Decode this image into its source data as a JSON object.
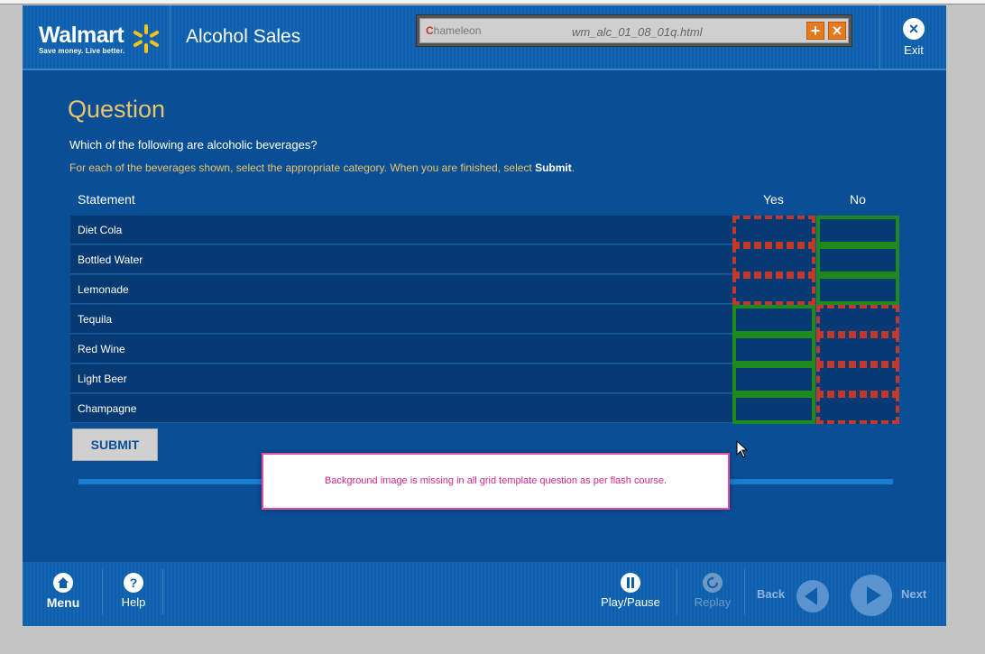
{
  "header": {
    "brand": "Walmart",
    "tagline": "Save money. Live better.",
    "app_title": "Alcohol Sales",
    "viewer": {
      "logo": "hameleon",
      "logo_initial": "C",
      "file": "wm_alc_01_08_01q.html",
      "plus_label": "+",
      "close_label": "×"
    },
    "exit_label": "Exit",
    "exit_icon": "×"
  },
  "question": {
    "heading": "Question",
    "text": "Which of the following are alcoholic beverages?",
    "instruction": "For each of the beverages shown, select the appropriate category.  When you are finished, select ",
    "instruction_bold": "Submit",
    "instruction_end": ".",
    "columns": {
      "statement": "Statement",
      "yes": "Yes",
      "no": "No"
    },
    "rows": [
      {
        "label": "Diet Cola",
        "yes": "wrong",
        "no": "correct"
      },
      {
        "label": "Bottled Water",
        "yes": "wrong",
        "no": "correct"
      },
      {
        "label": "Lemonade",
        "yes": "wrong",
        "no": "correct"
      },
      {
        "label": "Tequila",
        "yes": "correct",
        "no": "wrong"
      },
      {
        "label": "Red Wine",
        "yes": "correct",
        "no": "wrong"
      },
      {
        "label": "Light Beer",
        "yes": "correct",
        "no": "wrong"
      },
      {
        "label": "Champagne",
        "yes": "correct",
        "no": "wrong"
      }
    ],
    "submit_label": "SUBMIT"
  },
  "note": "Background image is missing in all grid template question as per flash course.",
  "footer": {
    "menu": "Menu",
    "help": "Help",
    "play_pause": "Play/Pause",
    "replay": "Replay",
    "back": "Back",
    "next": "Next"
  },
  "colors": {
    "brand_blue": "#0a4f96",
    "accent_gold": "#e8c56a",
    "correct": "#1e8a1e",
    "wrong": "#c0392b",
    "note_pink": "#d4278c"
  }
}
